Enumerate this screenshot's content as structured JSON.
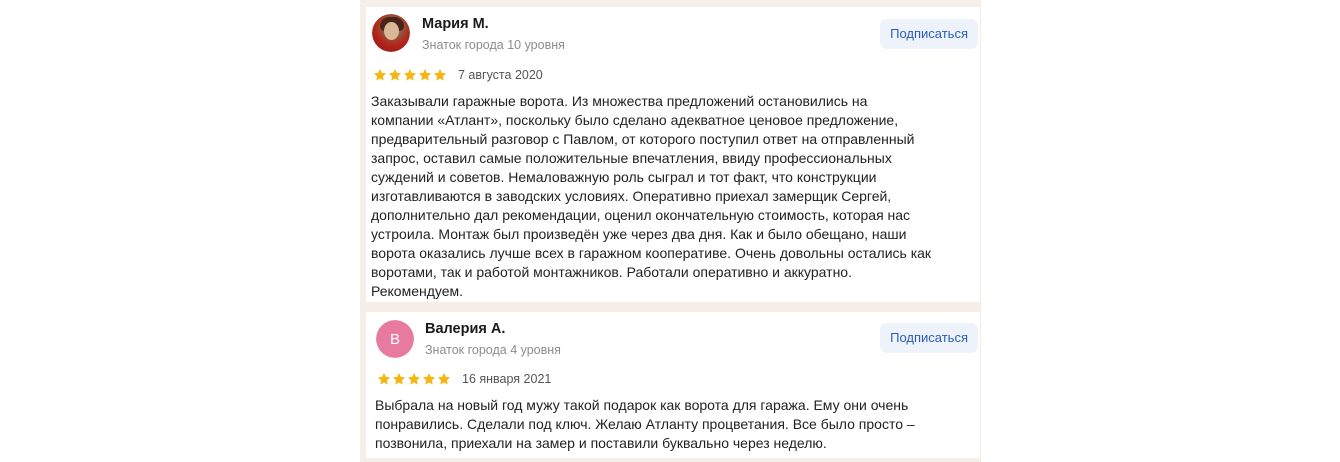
{
  "reviews": [
    {
      "author": "Мария М.",
      "level": "Знаток города 10 уровня",
      "subscribe_label": "Подписаться",
      "rating": 5,
      "date": "7 августа 2020",
      "avatar_icon": "user-photo-icon",
      "text": "Заказывали гаражные ворота. Из множества предложений остановились на\nкомпании «Атлант», поскольку было сделано адекватное ценовое предложение,\nпредварительный разговор с Павлом, от которого поступил ответ на отправленный\nзапрос, оставил самые положительные впечатления, ввиду профессиональных\nсуждений и советов. Немаловажную роль сыграл и тот факт, что конструкции\nизготавливаются в заводских условиях. Оперативно приехал замерщик Сергей,\nдополнительно дал рекомендации, оценил окончательную стоимость, которая нас\nустроила. Монтаж был произведён уже через два дня. Как и было обещано, наши\nворота оказались лучше всех в гаражном кооперативе. Очень довольны остались как\nворотами, так и работой монтажников. Работали оперативно и аккуратно.\nРекомендуем."
    },
    {
      "author": "Валерия А.",
      "avatar_letter": "В",
      "avatar_color": "#e8799f",
      "level": "Знаток города 4 уровня",
      "subscribe_label": "Подписаться",
      "rating": 5,
      "date": "16 января 2021",
      "text": "Выбрала на новый год мужу такой подарок как ворота для гаража. Ему они очень\nпонравились. Сделали под ключ. Желаю Атланту процветания. Все было просто –\nпозвонила, приехали на замер и поставили буквально через неделю."
    }
  ],
  "colors": {
    "star": "#f6b60f",
    "subscribe_text": "#2a5db8",
    "subscribe_bg": "#eef3fb",
    "backdrop": "#f6efe9"
  }
}
